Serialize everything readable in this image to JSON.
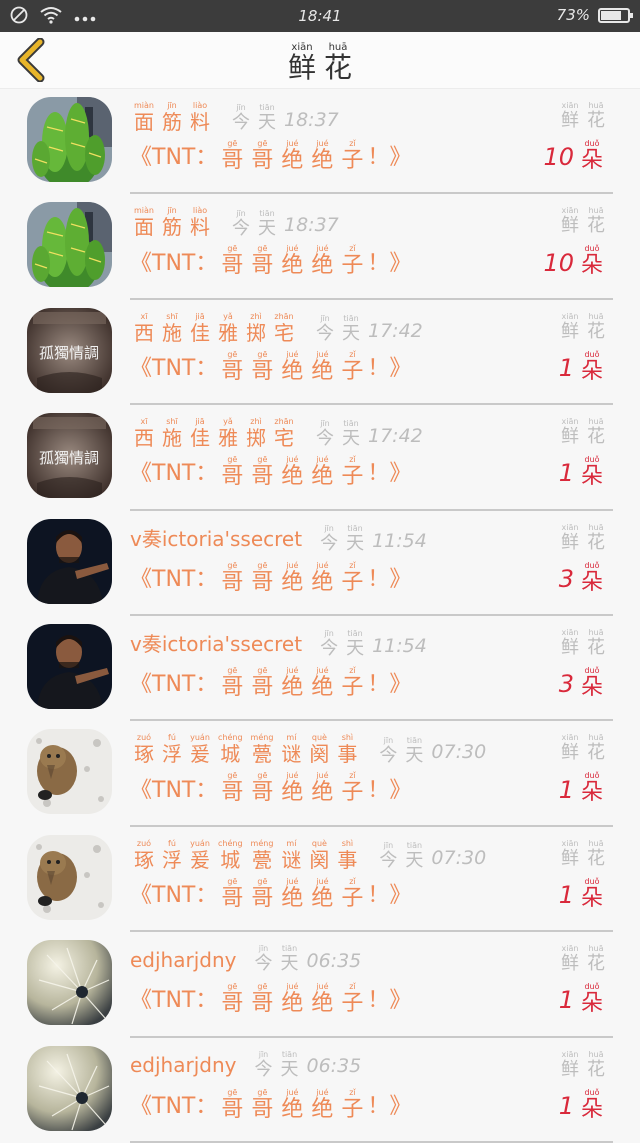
{
  "status": {
    "time": "18:41",
    "battery": "73%"
  },
  "nav": {
    "title": [
      {
        "py": "xiān",
        "hz": "鲜"
      },
      {
        "py": "huā",
        "hz": "花"
      }
    ]
  },
  "rows": [
    {
      "avatar": "cactus",
      "name_ruby": [
        [
          "miàn",
          "面"
        ],
        [
          "jīn",
          "筋"
        ],
        [
          "liào",
          "料"
        ]
      ],
      "name_latin": "",
      "time": "18:37",
      "count": "10"
    },
    {
      "avatar": "cactus",
      "name_ruby": [
        [
          "miàn",
          "面"
        ],
        [
          "jīn",
          "筋"
        ],
        [
          "liào",
          "料"
        ]
      ],
      "name_latin": "",
      "time": "18:37",
      "count": "10"
    },
    {
      "avatar": "lonely",
      "name_ruby": [
        [
          "xī",
          "西"
        ],
        [
          "shī",
          "施"
        ],
        [
          "jiā",
          "佳"
        ],
        [
          "yǎ",
          "雅"
        ],
        [
          "zhì",
          "掷"
        ],
        [
          "zhān",
          "宅"
        ]
      ],
      "name_latin": "",
      "time": "17:42",
      "count": "1"
    },
    {
      "avatar": "lonely",
      "name_ruby": [
        [
          "xī",
          "西"
        ],
        [
          "shī",
          "施"
        ],
        [
          "jiā",
          "佳"
        ],
        [
          "yǎ",
          "雅"
        ],
        [
          "zhì",
          "掷"
        ],
        [
          "zhān",
          "宅"
        ]
      ],
      "name_latin": "",
      "time": "17:42",
      "count": "1"
    },
    {
      "avatar": "man",
      "name_ruby": [],
      "name_latin": "v奏ictoria'ssecret",
      "time": "11:54",
      "count": "3"
    },
    {
      "avatar": "man",
      "name_ruby": [],
      "name_latin": "v奏ictoria'ssecret",
      "time": "11:54",
      "count": "3"
    },
    {
      "avatar": "cat",
      "name_ruby": [
        [
          "zuó",
          "琢"
        ],
        [
          "fú",
          "浮"
        ],
        [
          "yuán",
          "爰"
        ],
        [
          "chéng",
          "城"
        ],
        [
          "méng",
          "甍"
        ],
        [
          "mí",
          "谜"
        ],
        [
          "què",
          "阕"
        ],
        [
          "shì",
          "事"
        ]
      ],
      "name_latin": "",
      "time": "07:30",
      "count": "1"
    },
    {
      "avatar": "cat",
      "name_ruby": [
        [
          "zuó",
          "琢"
        ],
        [
          "fú",
          "浮"
        ],
        [
          "yuán",
          "爰"
        ],
        [
          "chéng",
          "城"
        ],
        [
          "méng",
          "甍"
        ],
        [
          "mí",
          "谜"
        ],
        [
          "què",
          "阕"
        ],
        [
          "shì",
          "事"
        ]
      ],
      "name_latin": "",
      "time": "07:30",
      "count": "1"
    },
    {
      "avatar": "dandelion",
      "name_ruby": [],
      "name_latin": "edjharjdny",
      "time": "06:35",
      "count": "1"
    },
    {
      "avatar": "dandelion",
      "name_ruby": [],
      "name_latin": "edjharjdny",
      "time": "06:35",
      "count": "1"
    }
  ],
  "shared": {
    "today": [
      {
        "py": "jīn",
        "hz": "今"
      },
      {
        "py": "tiān",
        "hz": "天"
      }
    ],
    "flowers": [
      {
        "py": "xiān",
        "hz": "鲜"
      },
      {
        "py": "huā",
        "hz": "花"
      }
    ],
    "message_prefix": "《TNT：",
    "message_ruby": [
      {
        "py": "gē",
        "hz": "哥"
      },
      {
        "py": "gē",
        "hz": "哥"
      },
      {
        "py": "jué",
        "hz": "绝"
      },
      {
        "py": "jué",
        "hz": "绝"
      },
      {
        "py": "zǐ",
        "hz": "子"
      }
    ],
    "message_suffix": "！》",
    "unit": {
      "py": "duǒ",
      "hz": "朵"
    }
  },
  "colors": {
    "accent": "#ee8a57",
    "count": "#d9293b",
    "muted": "#bdbdbd",
    "back": "#e8b52a"
  },
  "icons": {
    "back": "chevron-left-icon",
    "dnd": "do-not-disturb-icon",
    "wifi": "wifi-icon",
    "more": "more-dots-icon",
    "battery": "battery-icon"
  }
}
